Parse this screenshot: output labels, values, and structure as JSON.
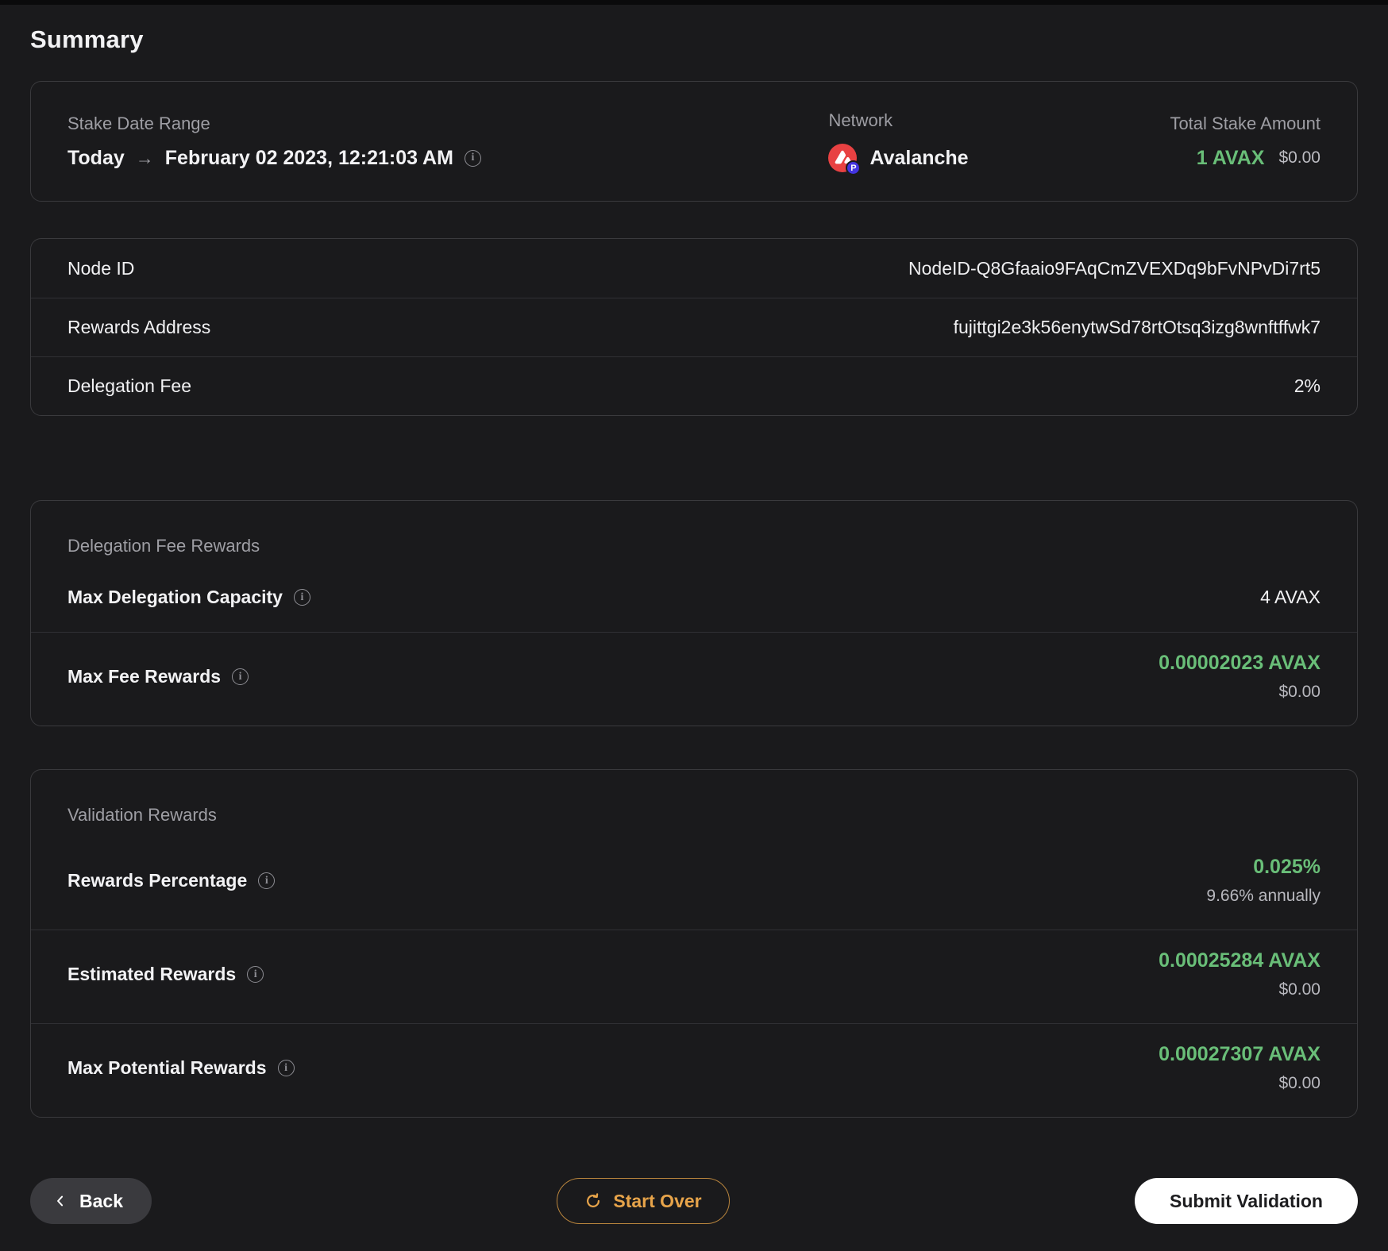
{
  "page": {
    "title": "Summary"
  },
  "icons": {
    "info": "i",
    "arrow_right": "→"
  },
  "colors": {
    "background": "#1a1a1c",
    "accent_green": "#69be78",
    "accent_orange": "#e7a44a",
    "avalanche_red": "#e84142",
    "p_chain_purple": "#4334e0"
  },
  "overview": {
    "date_range": {
      "label": "Stake Date Range",
      "start": "Today",
      "end": "February 02 2023, 12:21:03 AM"
    },
    "network": {
      "label": "Network",
      "name": "Avalanche",
      "badge_letter": "P"
    },
    "total_stake": {
      "label": "Total Stake Amount",
      "amount": "1 AVAX",
      "usd": "$0.00"
    }
  },
  "node_details": {
    "rows": [
      {
        "label": "Node ID",
        "value": "NodeID-Q8Gfaaio9FAqCmZVEXDq9bFvNPvDi7rt5"
      },
      {
        "label": "Rewards Address",
        "value": "fujittgi2e3k56enytwSd78rtOtsq3izg8wnftffwk7"
      },
      {
        "label": "Delegation Fee",
        "value": "2%"
      }
    ]
  },
  "delegation_fee_rewards": {
    "title": "Delegation Fee Rewards",
    "rows": [
      {
        "label": "Max Delegation Capacity",
        "value": "4 AVAX"
      },
      {
        "label": "Max Fee Rewards",
        "value": "0.00002023 AVAX",
        "sub": "$0.00"
      }
    ]
  },
  "validation_rewards": {
    "title": "Validation Rewards",
    "rows": [
      {
        "label": "Rewards Percentage",
        "value": "0.025%",
        "sub": "9.66% annually"
      },
      {
        "label": "Estimated Rewards",
        "value": "0.00025284 AVAX",
        "sub": "$0.00"
      },
      {
        "label": "Max Potential Rewards",
        "value": "0.00027307 AVAX",
        "sub": "$0.00"
      }
    ]
  },
  "footer": {
    "back_label": "Back",
    "start_over_label": "Start Over",
    "submit_label": "Submit Validation"
  }
}
